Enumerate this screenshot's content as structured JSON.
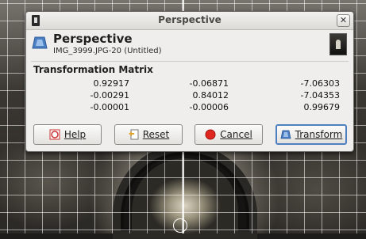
{
  "dialog": {
    "window_title": "Perspective",
    "header_title": "Perspective",
    "header_subtitle": "IMG_3999.JPG-20 (Untitled)",
    "section_title": "Transformation Matrix",
    "close_glyph": "✕"
  },
  "matrix": [
    [
      "0.92917",
      "-0.06871",
      "-7.06303"
    ],
    [
      "-0.00291",
      "0.84012",
      "-7.04353"
    ],
    [
      "-0.00001",
      "-0.00006",
      "0.99679"
    ]
  ],
  "buttons": {
    "help": {
      "label": "Help",
      "icon": "help-icon"
    },
    "reset": {
      "label": "Reset",
      "icon": "reset-icon"
    },
    "cancel": {
      "label": "Cancel",
      "icon": "cancel-icon"
    },
    "transform": {
      "label": "Transform",
      "icon": "perspective-icon"
    }
  },
  "colors": {
    "dialog_bg": "#efeeec",
    "default_button_border": "#4f7fbf",
    "cancel_icon": "#e0271f"
  }
}
